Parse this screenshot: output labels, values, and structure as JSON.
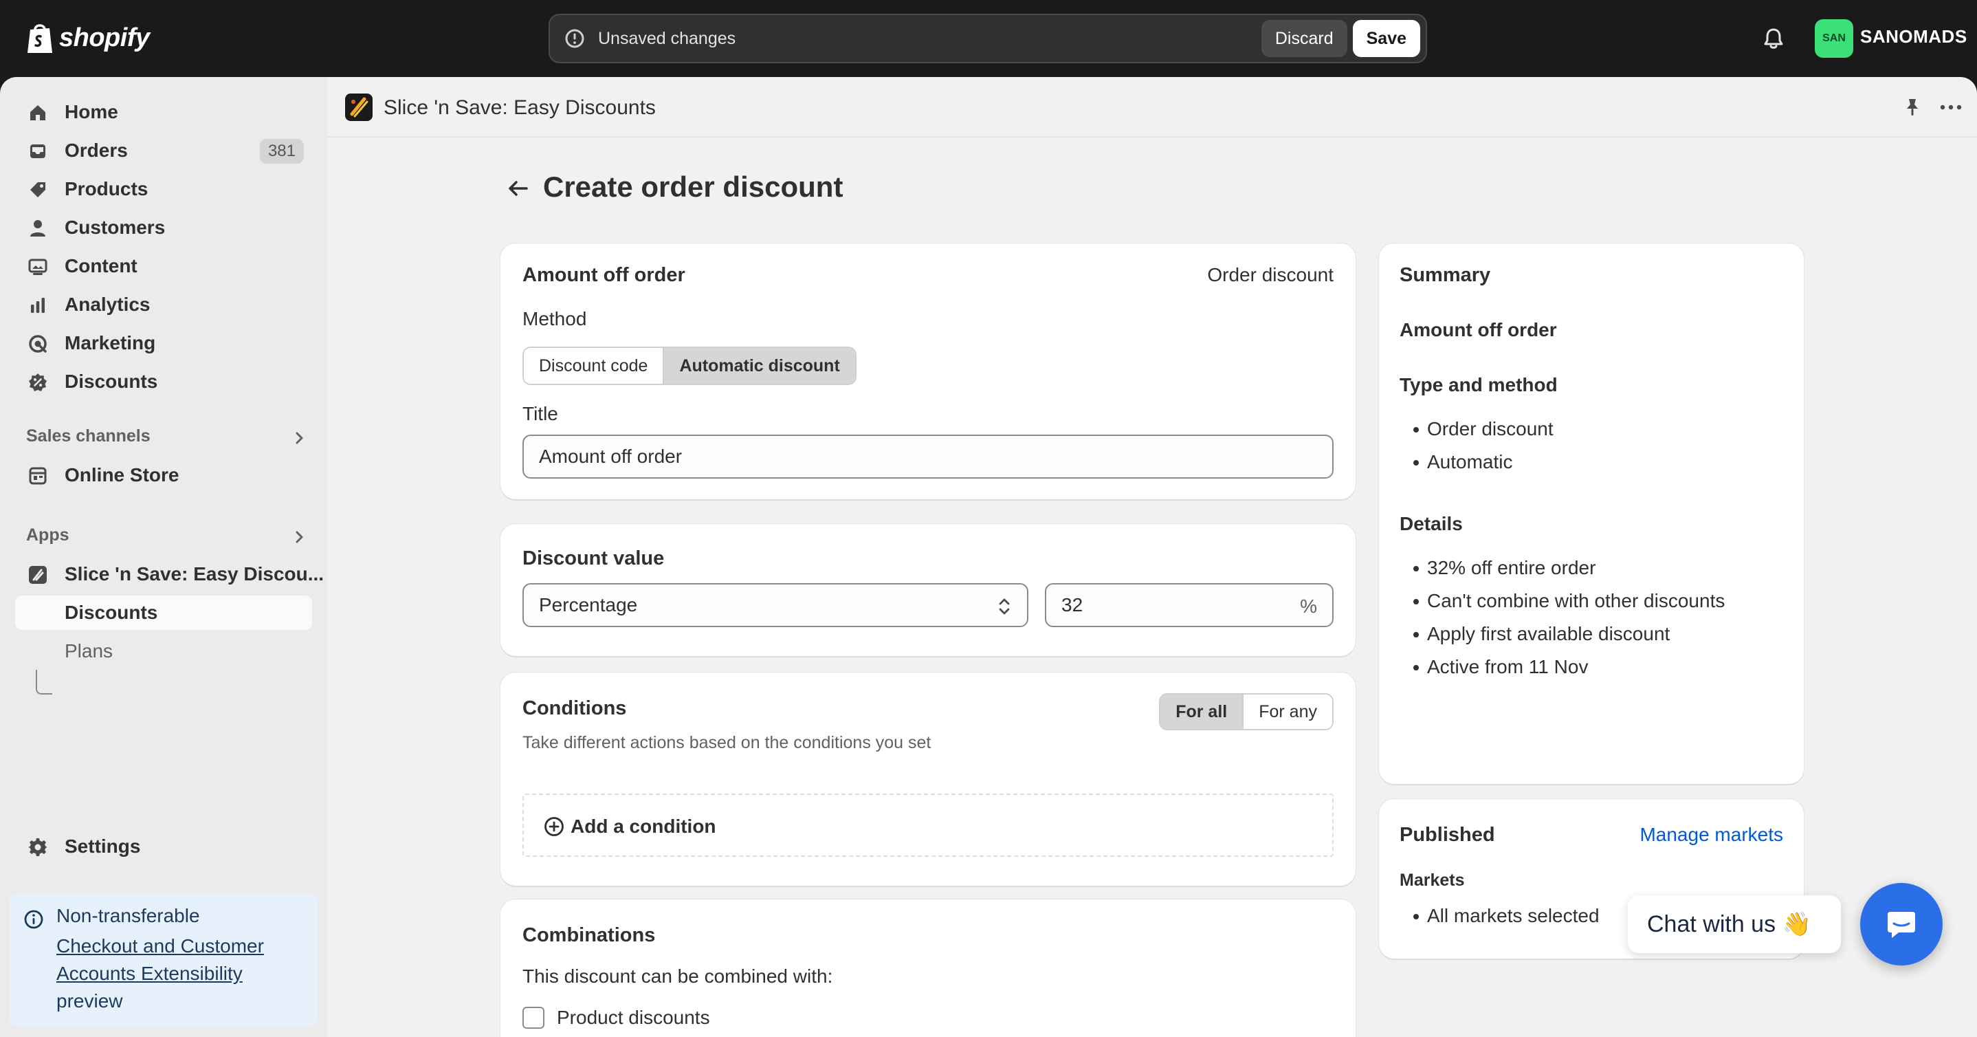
{
  "topbar": {
    "brand": "shopify",
    "unsaved_text": "Unsaved changes",
    "discard_label": "Discard",
    "save_label": "Save",
    "store_initials": "SAN",
    "store_name": "SANOMADS"
  },
  "sidebar": {
    "items": [
      {
        "label": "Home",
        "icon": "home-icon"
      },
      {
        "label": "Orders",
        "icon": "inbox-icon",
        "badge": "381"
      },
      {
        "label": "Products",
        "icon": "tag-icon"
      },
      {
        "label": "Customers",
        "icon": "person-icon"
      },
      {
        "label": "Content",
        "icon": "image-icon"
      },
      {
        "label": "Analytics",
        "icon": "bar-chart-icon"
      },
      {
        "label": "Marketing",
        "icon": "target-icon"
      },
      {
        "label": "Discounts",
        "icon": "discount-icon"
      }
    ],
    "sales_channels_label": "Sales channels",
    "online_store_label": "Online Store",
    "apps_label": "Apps",
    "app_label": "Slice 'n Save: Easy Discou...",
    "app_sub_discounts": "Discounts",
    "app_sub_plans": "Plans",
    "settings_label": "Settings",
    "notice": {
      "line1": "Non-transferable",
      "link": "Checkout and Customer Accounts Extensibility",
      "line3": "preview"
    }
  },
  "appbar": {
    "title": "Slice 'n Save: Easy Discounts"
  },
  "page": {
    "title": "Create order discount"
  },
  "amount_card": {
    "title": "Amount off order",
    "type_label": "Order discount",
    "method_label": "Method",
    "method_options": [
      "Discount code",
      "Automatic discount"
    ],
    "method_selected": "Automatic discount",
    "title_label": "Title",
    "title_value": "Amount off order"
  },
  "value_card": {
    "title": "Discount value",
    "type_selected": "Percentage",
    "amount_value": "32",
    "amount_suffix": "%"
  },
  "conditions_card": {
    "title": "Conditions",
    "subtitle": "Take different actions based on the conditions you set",
    "toggle_options": [
      "For all",
      "For any"
    ],
    "toggle_selected": "For all",
    "add_label": "Add a condition"
  },
  "combinations_card": {
    "title": "Combinations",
    "subtitle": "This discount can be combined with:",
    "options": [
      "Product discounts"
    ]
  },
  "summary": {
    "title": "Summary",
    "name": "Amount off order",
    "type_heading": "Type and method",
    "type_items": [
      "Order discount",
      "Automatic"
    ],
    "details_heading": "Details",
    "details_items": [
      "32% off entire order",
      "Can't combine with other discounts",
      "Apply first available discount",
      "Active from 11 Nov"
    ]
  },
  "published": {
    "title": "Published",
    "manage_link": "Manage markets",
    "markets_heading": "Markets",
    "markets_items": [
      "All markets selected"
    ]
  },
  "chat": {
    "label": "Chat with us 👋"
  },
  "colors": {
    "accent_link": "#005bd3",
    "chat_button": "#2b6fe8",
    "store_avatar": "#3be078"
  }
}
